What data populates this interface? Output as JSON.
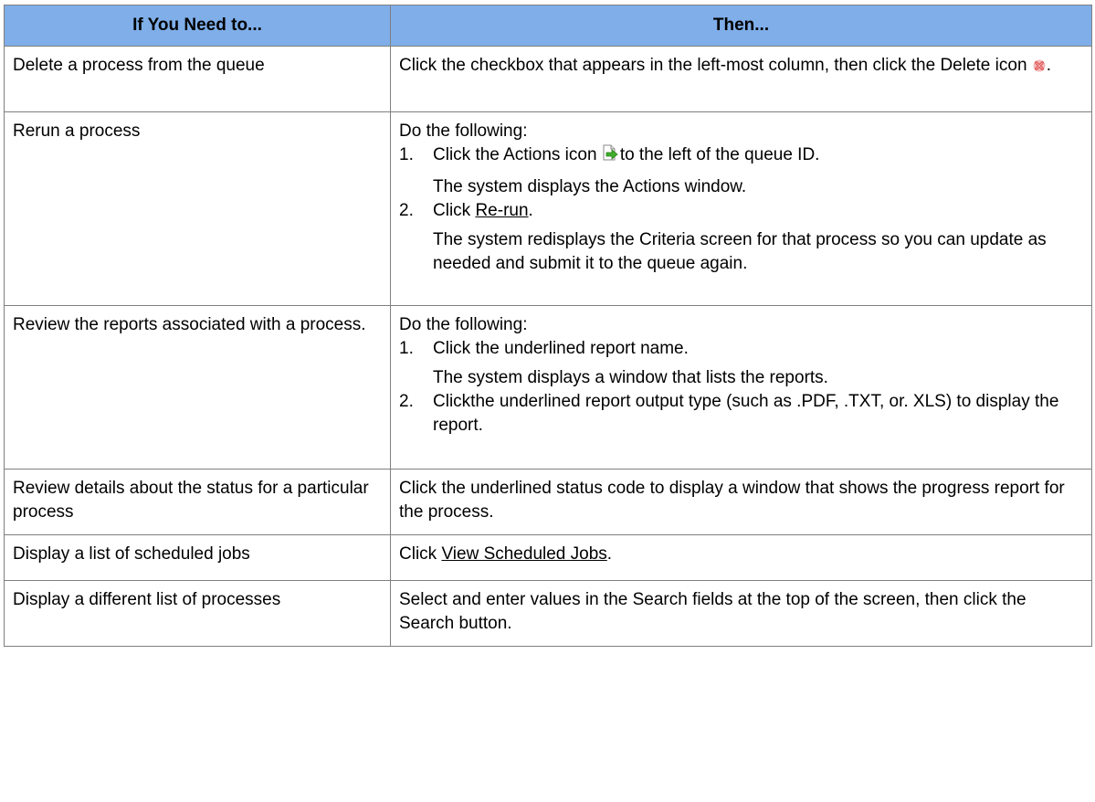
{
  "header": {
    "col1": "If You Need to...",
    "col2": "Then..."
  },
  "rows": [
    {
      "need": "Delete a process from the queue",
      "then_before": "Click the checkbox that appears in the left-most column, then click the Delete icon",
      "then_after": ".",
      "icon": "delete-icon"
    },
    {
      "need": "Rerun a process",
      "intro": "Do the following:",
      "steps": [
        {
          "num": "1.",
          "text_before": "Click the Actions icon",
          "text_after": "to the left of the queue ID.",
          "icon": "actions-icon",
          "result": "The system displays the Actions window."
        },
        {
          "num": "2.",
          "text_before": "Click",
          "link": "Re-run",
          "text_after": ".",
          "result": "The system redisplays the Criteria screen for that process so you can update as needed and submit it to the queue again."
        }
      ]
    },
    {
      "need": "Review the reports associated with a process.",
      "intro": "Do the following:",
      "steps": [
        {
          "num": "1.",
          "text": "Click the underlined report name.",
          "result": "The system displays a window that lists the reports."
        },
        {
          "num": "2.",
          "text": "Clickthe underlined report output type (such as .PDF, .TXT, or. XLS) to display the report."
        }
      ]
    },
    {
      "need": "Review details about the status for a particular process",
      "then": "Click the underlined status code to display a window that shows the progress report for the process."
    },
    {
      "need": "Display a list of scheduled jobs",
      "then_before": "Click",
      "link": "View Scheduled Jobs",
      "then_after": "."
    },
    {
      "need": "Display a different list of processes",
      "then": "Select and enter values in the Search fields at the top of the screen, then click the Search button."
    }
  ]
}
